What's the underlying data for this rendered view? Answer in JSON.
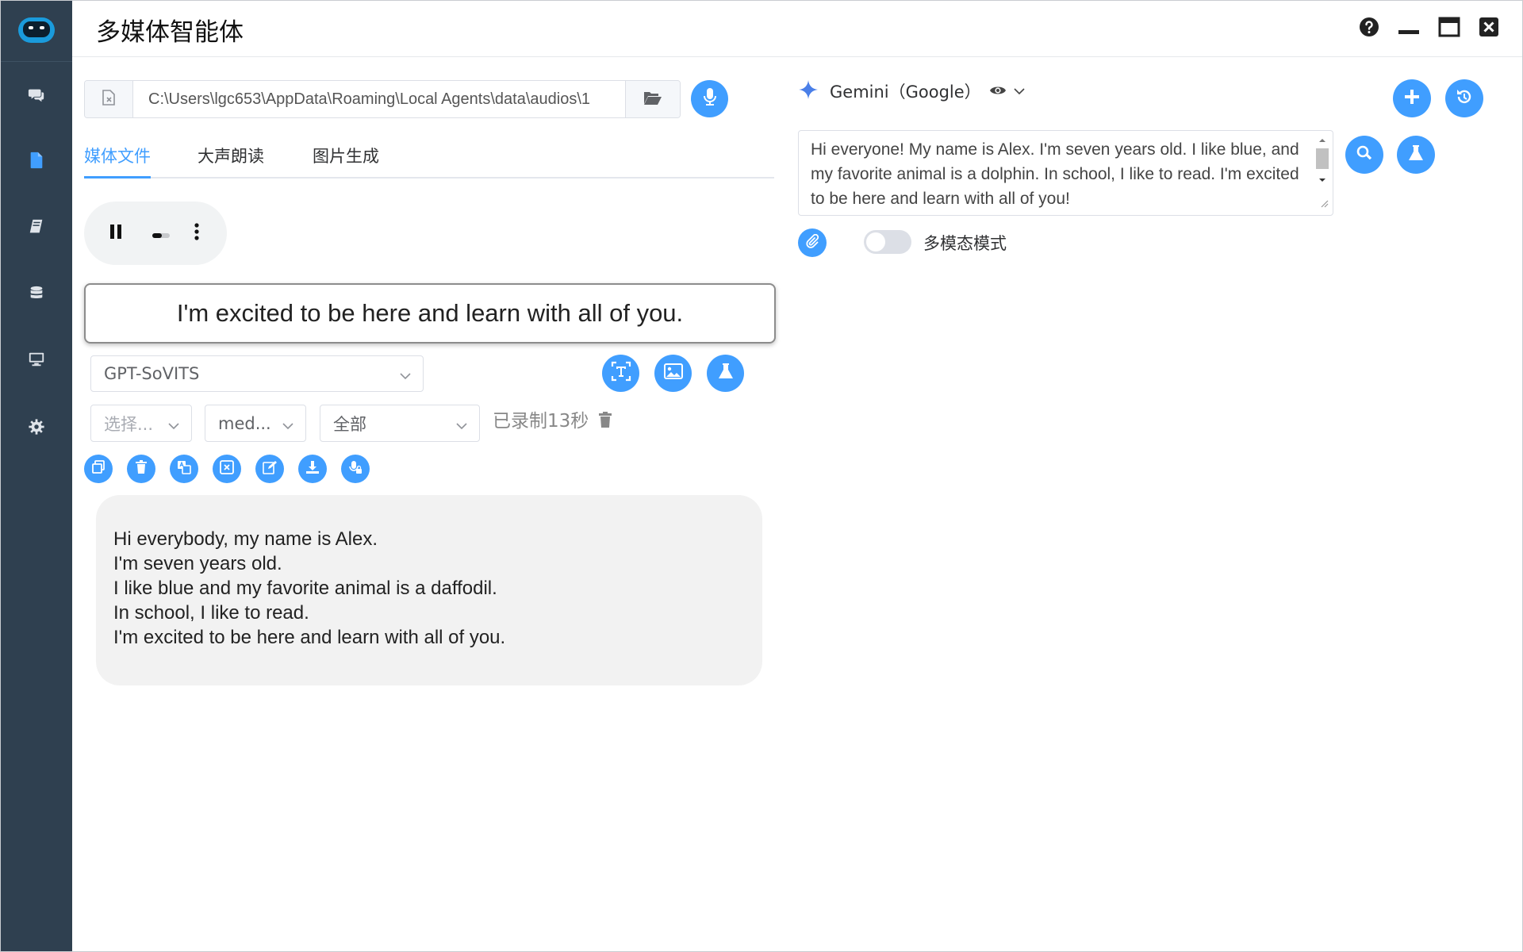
{
  "app": {
    "title": "多媒体智能体"
  },
  "sidebar": {
    "items": [
      {
        "name": "chat",
        "icon": "chat-icon"
      },
      {
        "name": "document",
        "icon": "file-icon",
        "active": true
      },
      {
        "name": "book",
        "icon": "book-icon"
      },
      {
        "name": "database",
        "icon": "database-icon"
      },
      {
        "name": "monitor",
        "icon": "monitor-icon"
      },
      {
        "name": "settings",
        "icon": "gear-icon"
      }
    ],
    "active_color": "#409eff"
  },
  "path": {
    "value": "C:\\Users\\lgc653\\AppData\\Roaming\\Local Agents\\data\\audios\\1"
  },
  "tabs": [
    {
      "label": "媒体文件",
      "active": true
    },
    {
      "label": "大声朗读",
      "active": false
    },
    {
      "label": "图片生成",
      "active": false
    }
  ],
  "subtitle": {
    "text": "I'm excited to be here and learn with all of you."
  },
  "tts": {
    "engine": "GPT-SoVITS",
    "voice_placeholder": "选择...",
    "model": "med...",
    "scope": "全部",
    "recorded": "已录制13秒"
  },
  "transcript": {
    "lines": [
      "Hi everybody, my name is Alex.",
      "I'm seven years old.",
      "I like blue and my favorite animal is a daffodil.",
      "In school, I like to read.",
      "I'm excited to be here and learn with all of you."
    ]
  },
  "chat": {
    "model": "Gemini（Google）",
    "input_text": "Hi everyone! My name is Alex. I'm seven years old. I like blue, and my favorite animal is a dolphin. In school, I like to read. I'm excited to be here and learn with all of you!",
    "multimodal_label": "多模态模式",
    "multimodal_on": false
  },
  "colors": {
    "accent": "#409eff",
    "sidebar": "#2f4050"
  }
}
